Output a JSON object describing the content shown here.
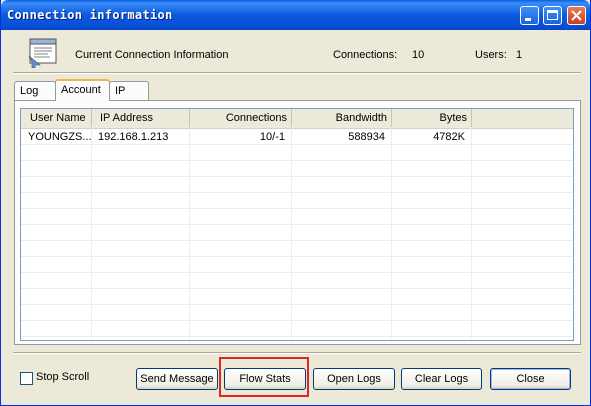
{
  "window": {
    "title": "Connection information"
  },
  "header": {
    "label": "Current Connection Information",
    "connections_label": "Connections:",
    "connections_value": "10",
    "users_label": "Users:",
    "users_value": "1"
  },
  "tabs": [
    {
      "label": "Log",
      "active": false
    },
    {
      "label": "Account",
      "active": true
    },
    {
      "label": "IP",
      "active": false
    }
  ],
  "table": {
    "columns": [
      "User Name",
      "IP Address",
      "Connections",
      "Bandwidth",
      "Bytes"
    ],
    "rows": [
      [
        "YOUNGZS...",
        "192.168.1.213",
        "10/-1",
        "588934",
        "4782K"
      ]
    ]
  },
  "footer": {
    "stop_scroll_label": "Stop Scroll",
    "stop_scroll_checked": false,
    "buttons": {
      "send_message": "Send Message",
      "flow_stats": "Flow Stats",
      "open_logs": "Open Logs",
      "clear_logs": "Clear Logs",
      "close": "Close"
    }
  },
  "colors": {
    "titlebar": "#0a5ee6",
    "highlight": "#e0242a"
  }
}
